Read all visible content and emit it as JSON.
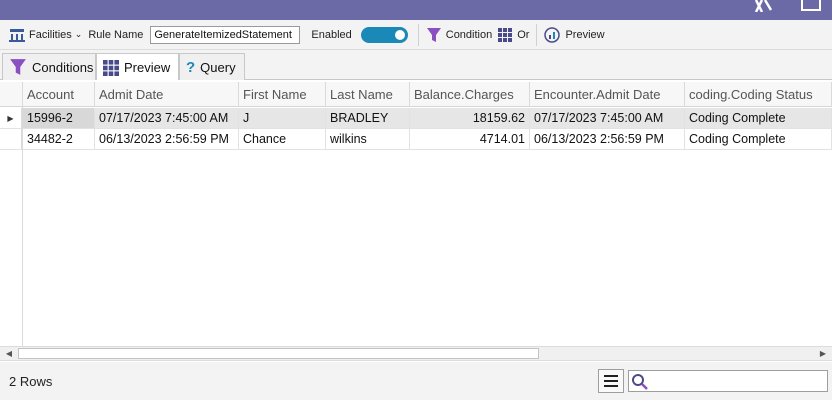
{
  "toolbar": {
    "facilities_label": "Facilities",
    "rule_name_label": "Rule Name",
    "rule_name_value": "GenerateItemizedStatement",
    "enabled_label": "Enabled",
    "enabled_on": true,
    "condition_label": "Condition",
    "or_label": "Or",
    "preview_label": "Preview"
  },
  "tabs": [
    {
      "label": "Conditions",
      "icon": "funnel-icon",
      "active": false
    },
    {
      "label": "Preview",
      "icon": "grid-icon",
      "active": true
    },
    {
      "label": "Query",
      "icon": "question-icon",
      "active": false
    }
  ],
  "grid": {
    "columns": [
      "Account",
      "Admit Date",
      "First Name",
      "Last Name",
      "Balance.Charges",
      "Encounter.Admit Date",
      "coding.Coding Status"
    ],
    "rows": [
      {
        "cells": [
          "15996-2",
          "07/17/2023 7:45:00 AM",
          "J",
          "BRADLEY",
          "18159.62",
          "07/17/2023 7:45:00 AM",
          "Coding Complete"
        ],
        "selected": true
      },
      {
        "cells": [
          "34482-2",
          "06/13/2023 2:56:59 PM",
          "Chance",
          "wilkins",
          "4714.01",
          "06/13/2023 2:56:59 PM",
          "Coding Complete"
        ],
        "selected": false
      }
    ]
  },
  "status": {
    "rows_count": "2 Rows",
    "search_value": ""
  },
  "colors": {
    "titlebar": "#6b6aa6",
    "toggle": "#1a89b8",
    "funnel": "#8a4fc0",
    "grid_icon": "#4a4a8a",
    "query_icon": "#1a89b8"
  }
}
